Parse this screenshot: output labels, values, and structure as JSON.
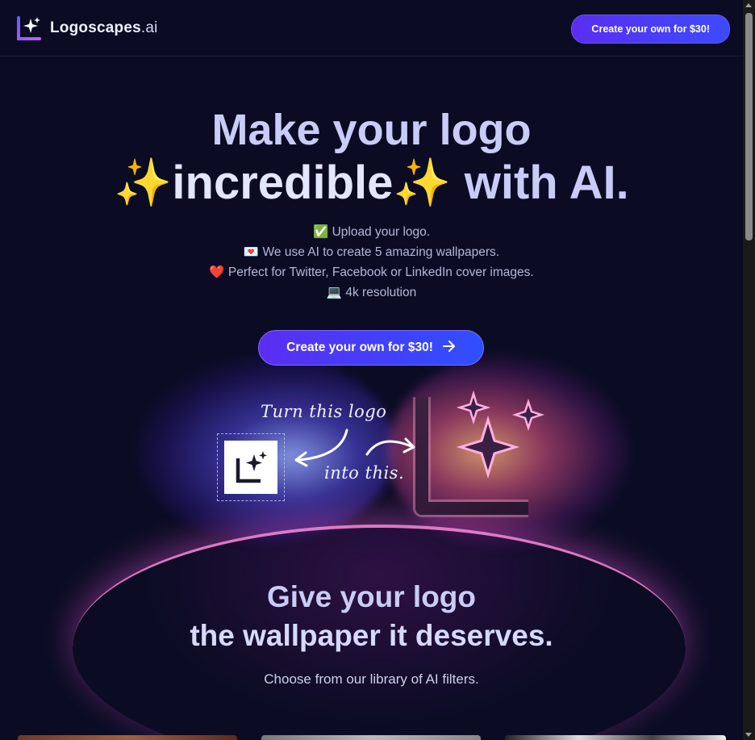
{
  "header": {
    "brand_name": "Logoscapes",
    "brand_tld": ".ai",
    "cta_label": "Create your own for $30!"
  },
  "hero": {
    "title_line1": "Make your logo",
    "title_sparkle": "✨",
    "title_highlight": "incredible",
    "title_tail": " with AI.",
    "features": [
      {
        "icon": "✅",
        "text": "Upload your logo."
      },
      {
        "icon": "💌",
        "text": "We use AI to create 5 amazing wallpapers."
      },
      {
        "icon": "❤️",
        "text": "Perfect for Twitter, Facebook or LinkedIn cover images."
      },
      {
        "icon": "💻",
        "text": "4k resolution"
      }
    ],
    "cta_label": "Create your own for $30!",
    "cta_icon": "arrow-right-icon"
  },
  "illustration": {
    "label_turn": "Turn this logo",
    "label_into": "into this."
  },
  "section2": {
    "title_line1": "Give your logo",
    "title_line2": "the wallpaper it deserves.",
    "subtitle": "Choose from our library of AI filters."
  },
  "colors": {
    "background": "#0b0c24",
    "accent": "#5a2ef2",
    "title": "#c9ccf6"
  }
}
